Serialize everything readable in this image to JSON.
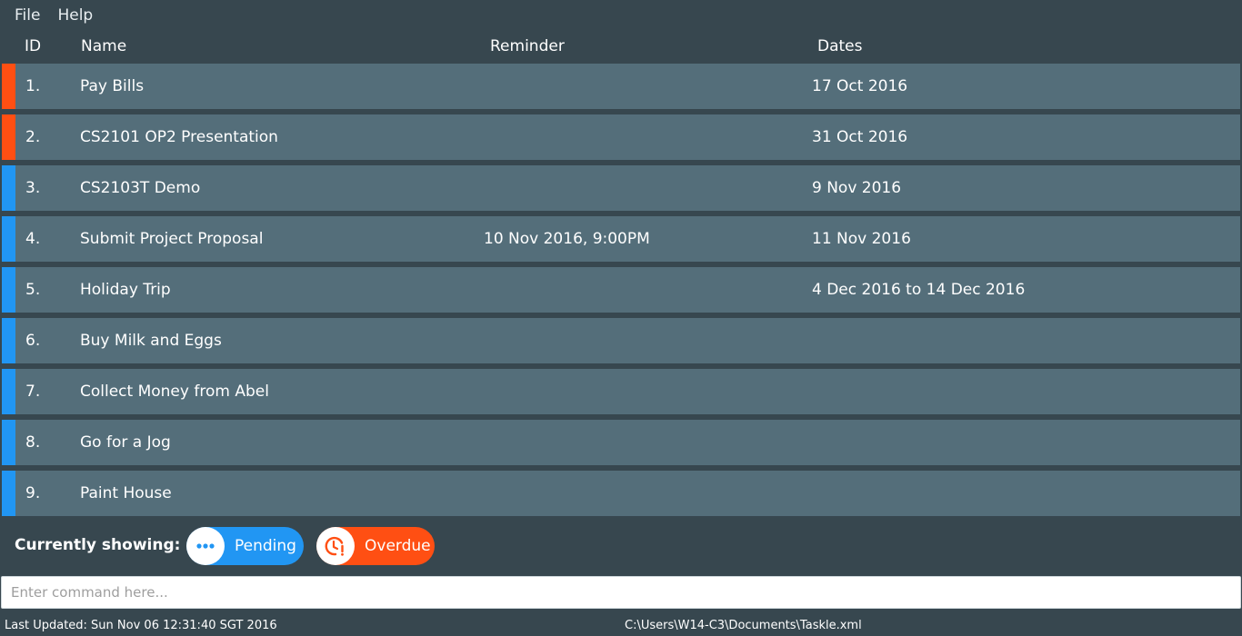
{
  "menu": {
    "items": [
      "File",
      "Help"
    ]
  },
  "columns": {
    "id": "ID",
    "name": "Name",
    "reminder": "Reminder",
    "dates": "Dates"
  },
  "colors": {
    "overdue": "#ff4f13",
    "pending": "#2196f3",
    "row_bg": "#546e7a",
    "app_bg": "#37474f"
  },
  "tasks": [
    {
      "id": "1.",
      "name": "Pay Bills",
      "reminder": "",
      "dates": "17 Oct 2016",
      "status": "overdue"
    },
    {
      "id": "2.",
      "name": "CS2101 OP2 Presentation",
      "reminder": "",
      "dates": "31 Oct 2016",
      "status": "overdue"
    },
    {
      "id": "3.",
      "name": "CS2103T Demo",
      "reminder": "",
      "dates": "9 Nov 2016",
      "status": "pending"
    },
    {
      "id": "4.",
      "name": "Submit Project Proposal",
      "reminder": "10 Nov 2016, 9:00PM",
      "dates": "11 Nov 2016",
      "status": "pending"
    },
    {
      "id": "5.",
      "name": "Holiday Trip",
      "reminder": "",
      "dates": "4 Dec 2016 to 14 Dec 2016",
      "status": "pending"
    },
    {
      "id": "6.",
      "name": "Buy Milk and Eggs",
      "reminder": "",
      "dates": "",
      "status": "pending"
    },
    {
      "id": "7.",
      "name": "Collect Money from Abel",
      "reminder": "",
      "dates": "",
      "status": "pending"
    },
    {
      "id": "8.",
      "name": "Go for a Jog",
      "reminder": "",
      "dates": "",
      "status": "pending"
    },
    {
      "id": "9.",
      "name": "Paint House",
      "reminder": "",
      "dates": "",
      "status": "pending"
    }
  ],
  "filter": {
    "label": "Currently showing:",
    "chips": [
      {
        "label": "Pending",
        "icon": "more-dots-icon"
      },
      {
        "label": "Overdue",
        "icon": "clock-alert-icon"
      }
    ]
  },
  "command": {
    "value": "",
    "placeholder": "Enter command here..."
  },
  "status": {
    "last_updated": "Last Updated: Sun Nov 06 12:31:40 SGT 2016",
    "file_path": "C:\\Users\\W14-C3\\Documents\\Taskle.xml"
  }
}
